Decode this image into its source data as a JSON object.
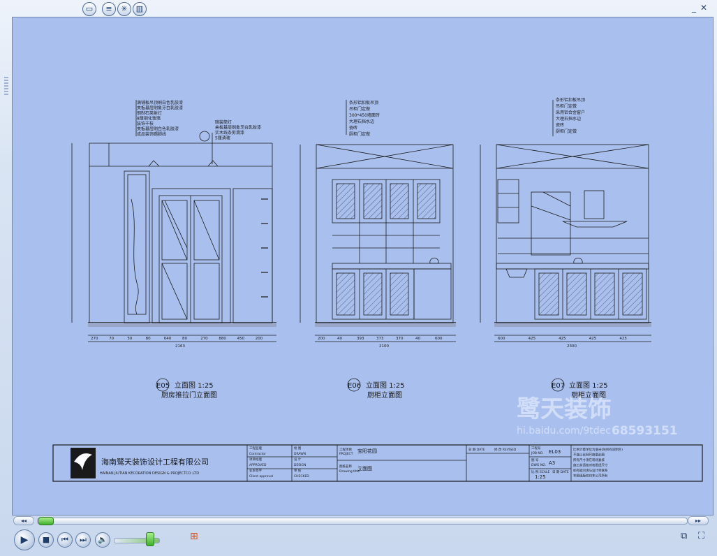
{
  "player": {
    "toolbar_icons": [
      "folder-icon",
      "list-icon",
      "visualization-icon",
      "graph-icon"
    ],
    "window_controls": [
      "minimize-icon",
      "close-icon"
    ]
  },
  "drawing": {
    "elevations": [
      {
        "code": "E05",
        "title": "立面图 1:25",
        "subtitle": "厨房推拉门立面图",
        "annotations": [
          "满铺板吊顶刷白色乳胶漆",
          "夹板基层刷象牙白乳胶漆",
          "钢制石英射灯",
          "8厘钢化玻璃",
          "装饰干枝",
          "夹板基层刷白色乳胶漆",
          "成品装饰踢脚线",
          "暗装筒灯",
          "夹板基层刷象牙白乳胶漆",
          "实木线条剪滑漆",
          "5厘清玻"
        ],
        "dims": [
          "270",
          "70",
          "50",
          "80",
          "640",
          "80",
          "270",
          "880",
          "450",
          "200"
        ],
        "total": "2163"
      },
      {
        "code": "E06",
        "title": "立面图 1:25",
        "subtitle": "厨柜立面图",
        "annotations": [
          "条形铝扣板吊顶",
          "吊柜门定做",
          "300*450墙面砖",
          "大理石挡水边",
          "瓷砖",
          "厨柜门定做"
        ],
        "dims": [
          "200",
          "40",
          "393",
          "373",
          "370",
          "40",
          "600"
        ],
        "total": "2100"
      },
      {
        "code": "E07",
        "title": "立面图 1:25",
        "subtitle": "厨柜立面图",
        "annotations": [
          "条形铝扣板吊顶",
          "吊柜门定做",
          "采用铝合金窗户",
          "大理石挡水边",
          "瓷砖",
          "厨柜门定做"
        ],
        "dims": [
          "600",
          "425",
          "425",
          "425",
          "425"
        ],
        "total": "2300"
      }
    ],
    "watermark": {
      "brand": "鹭天装饰",
      "site": "hi.baidu.com/9tdec",
      "phone": "68593151"
    },
    "titleblock": {
      "company_cn": "海南鹭天装饰设计工程有限公司",
      "company_en": "HAINAN JIUTIAN KECORATION DESIGN & PROJECTCO..LTD",
      "labels_col1": [
        "工程监理",
        "Contractor",
        "项目经理",
        "APPROVED",
        "业主签字",
        "Client approval"
      ],
      "labels_col2": [
        "绘 图",
        "DRAWN",
        "设 计",
        "DESIGN",
        "审 核",
        "CHECKED"
      ],
      "project_label": "工程项目",
      "project_label_en": "PROJECT",
      "project_name": "宝阳花园",
      "drawing_label": "图纸名称",
      "drawing_label_en": "Drawing title",
      "drawing_name": "立面图",
      "date_label": "日 期 DATE",
      "rev_label": "修 改 REVISED",
      "job_label": "工程号",
      "job_label_en": "JOB NO.",
      "job_no": "EL03",
      "sheet_label": "图 号",
      "sheet_label_en": "DWG NO.",
      "sheet_no": "A3",
      "scale_label": "比 例 SCALE",
      "scale": "1:25",
      "date2_label": "日 期 DATE",
      "notes": [
        "比例计量单位为毫米(除另有说明外)",
        "不能以比例尺度量此图",
        "所有尺寸须在现场复核",
        "施工前请核对各图纸尺寸",
        "如有疑问请与设计师联系",
        "本图纸版权归本公司所有"
      ]
    }
  }
}
